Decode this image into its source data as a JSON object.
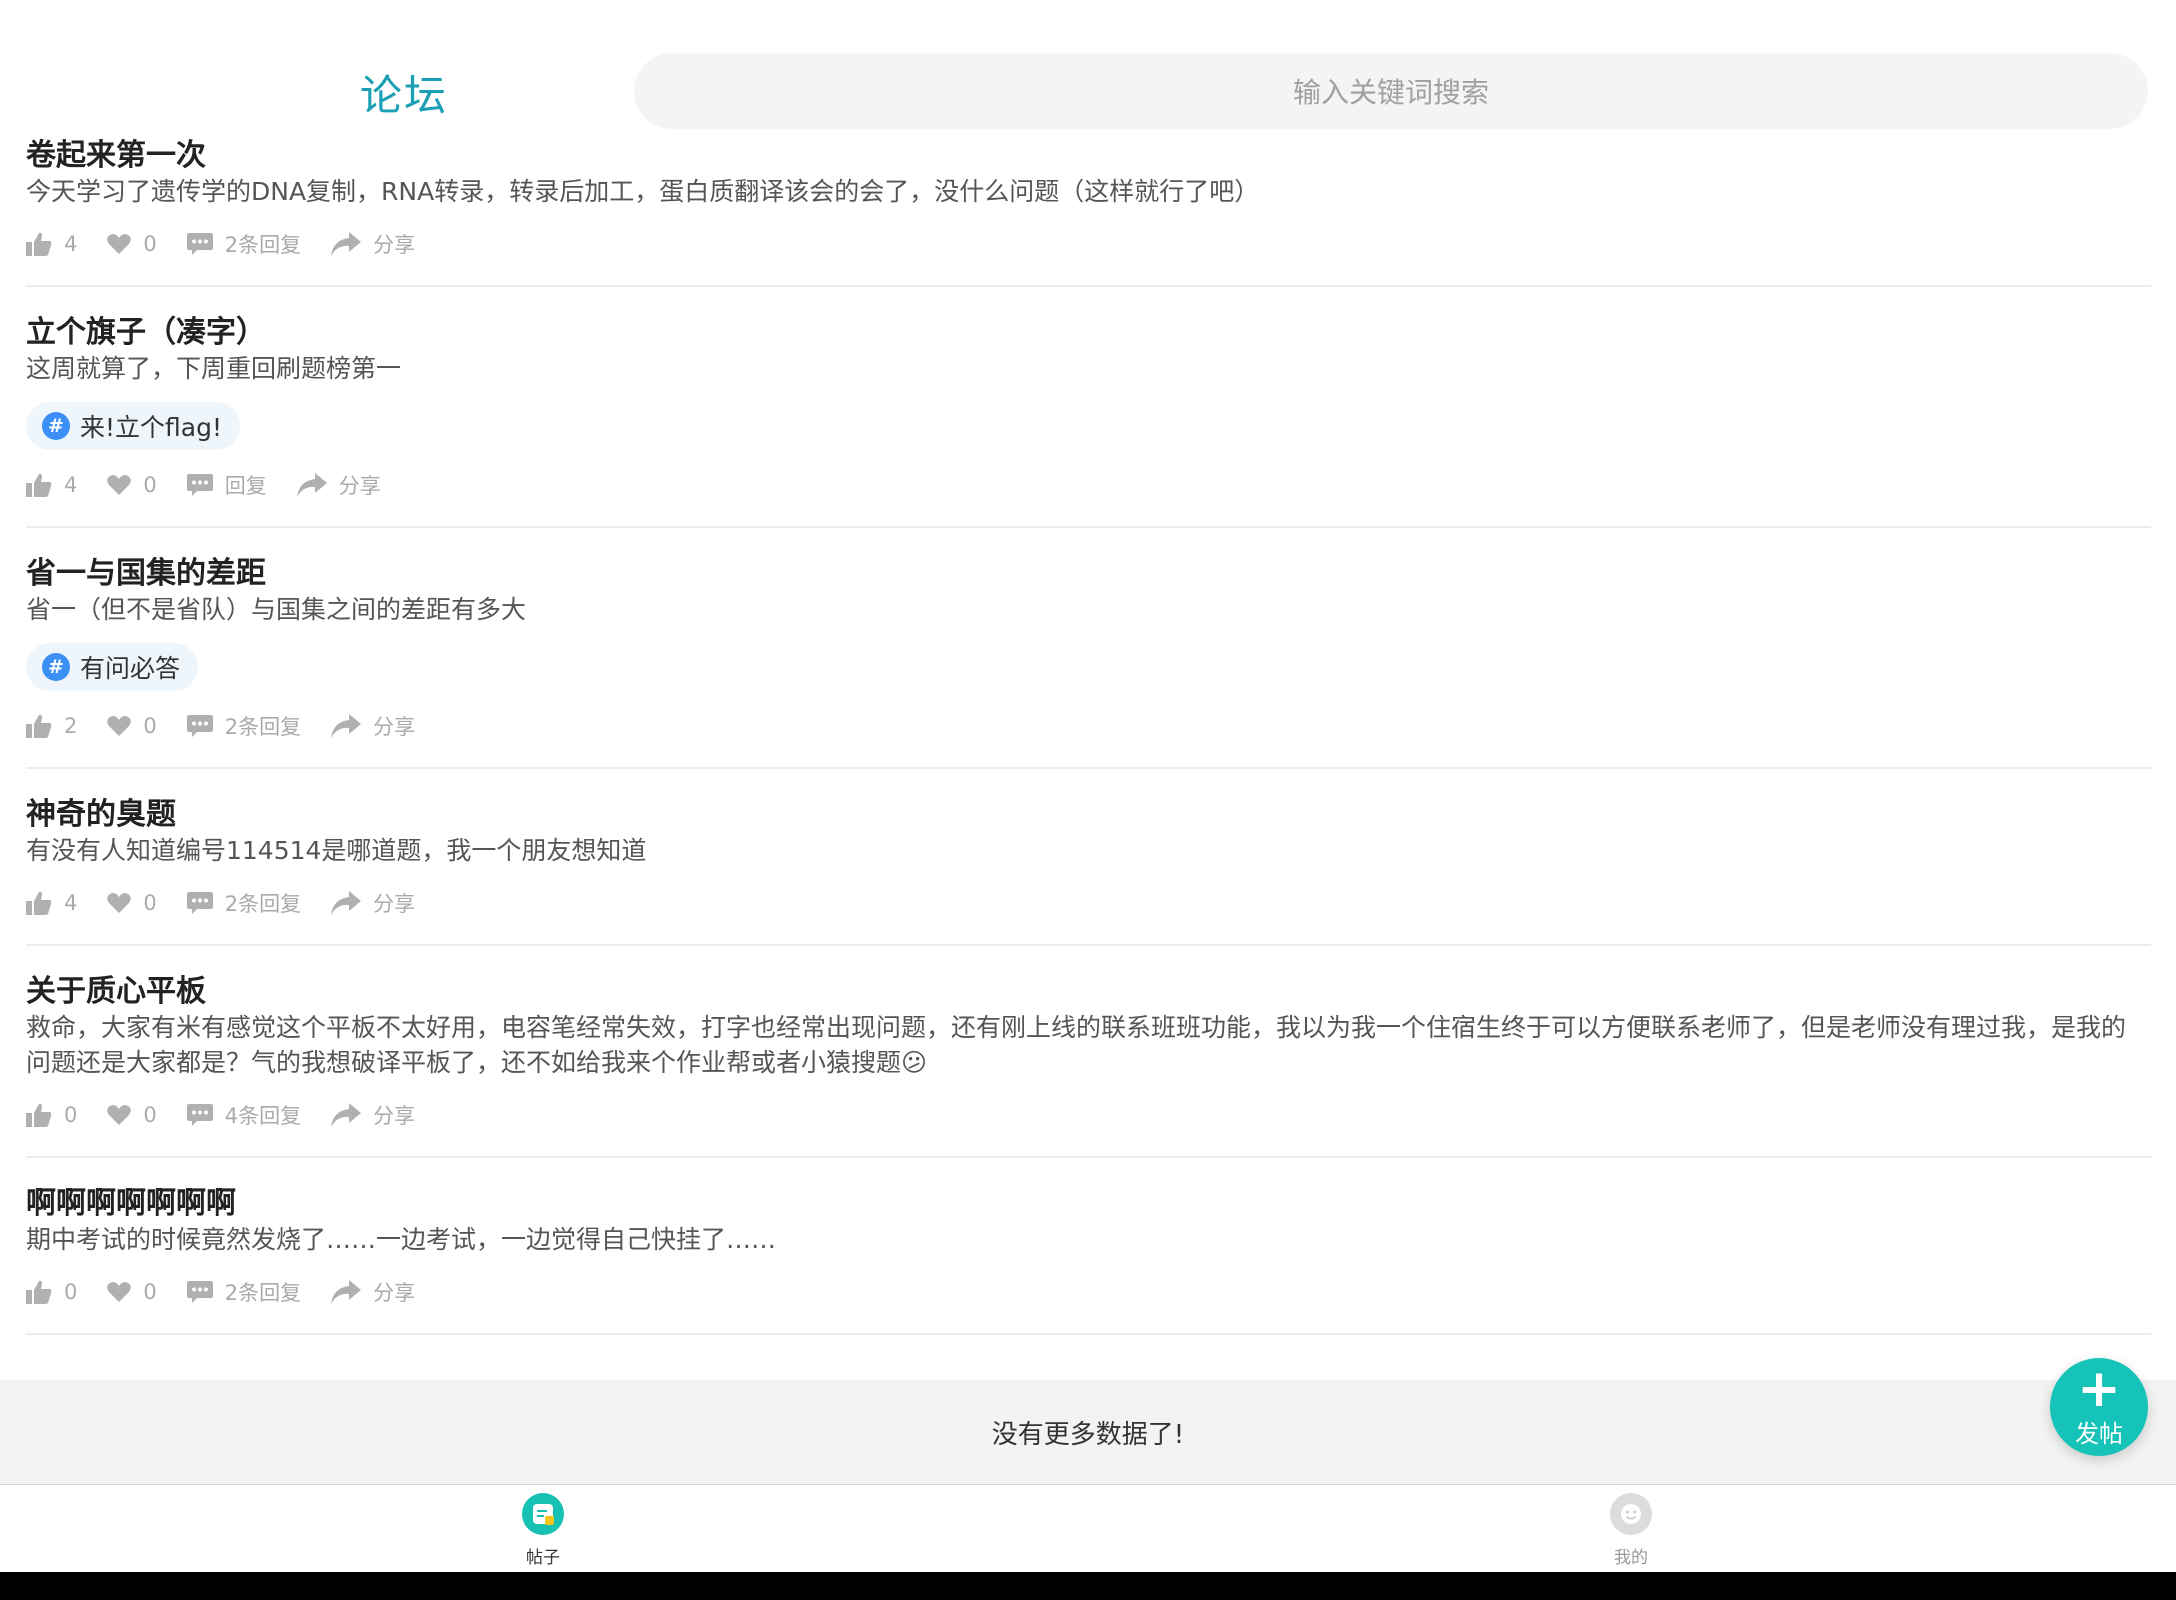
{
  "header": {
    "title": "论坛",
    "search_placeholder": "输入关键词搜索"
  },
  "posts": [
    {
      "title": "卷起来第一次",
      "body": "今天学习了遗传学的DNA复制，RNA转录，转录后加工，蛋白质翻译该会的会了，没什么问题（这样就行了吧）",
      "likes": "4",
      "favs": "0",
      "replies": "2条回复",
      "share": "分享"
    },
    {
      "title": "立个旗子（凑字）",
      "body": "这周就算了，下周重回刷题榜第一",
      "tag": "来!立个flag!",
      "likes": "4",
      "favs": "0",
      "replies": "回复",
      "share": "分享"
    },
    {
      "title": "省一与国集的差距",
      "body": "省一（但不是省队）与国集之间的差距有多大",
      "tag": "有问必答",
      "likes": "2",
      "favs": "0",
      "replies": "2条回复",
      "share": "分享"
    },
    {
      "title": "神奇的臭题",
      "body": "有没有人知道编号114514是哪道题，我一个朋友想知道",
      "likes": "4",
      "favs": "0",
      "replies": "2条回复",
      "share": "分享"
    },
    {
      "title": "关于质心平板",
      "body": "救命，大家有米有感觉这个平板不太好用，电容笔经常失效，打字也经常出现问题，还有刚上线的联系班班功能，我以为我一个住宿生终于可以方便联系老师了，但是老师没有理过我，是我的问题还是大家都是？气的我想破译平板了，还不如给我来个作业帮或者小猿搜题😕",
      "likes": "0",
      "favs": "0",
      "replies": "4条回复",
      "share": "分享"
    },
    {
      "title": "啊啊啊啊啊啊啊",
      "body": "期中考试的时候竟然发烧了……一边考试，一边觉得自己快挂了……",
      "likes": "0",
      "favs": "0",
      "replies": "2条回复",
      "share": "分享"
    }
  ],
  "list_footer": "没有更多数据了!",
  "fab": {
    "plus": "+",
    "label": "发帖"
  },
  "tabbar": {
    "posts_label": "帖子",
    "mine_label": "我的"
  },
  "colors": {
    "accent": "#1a9fb5",
    "fab": "#15c3b8",
    "tag_icon": "#3b8ff5"
  }
}
